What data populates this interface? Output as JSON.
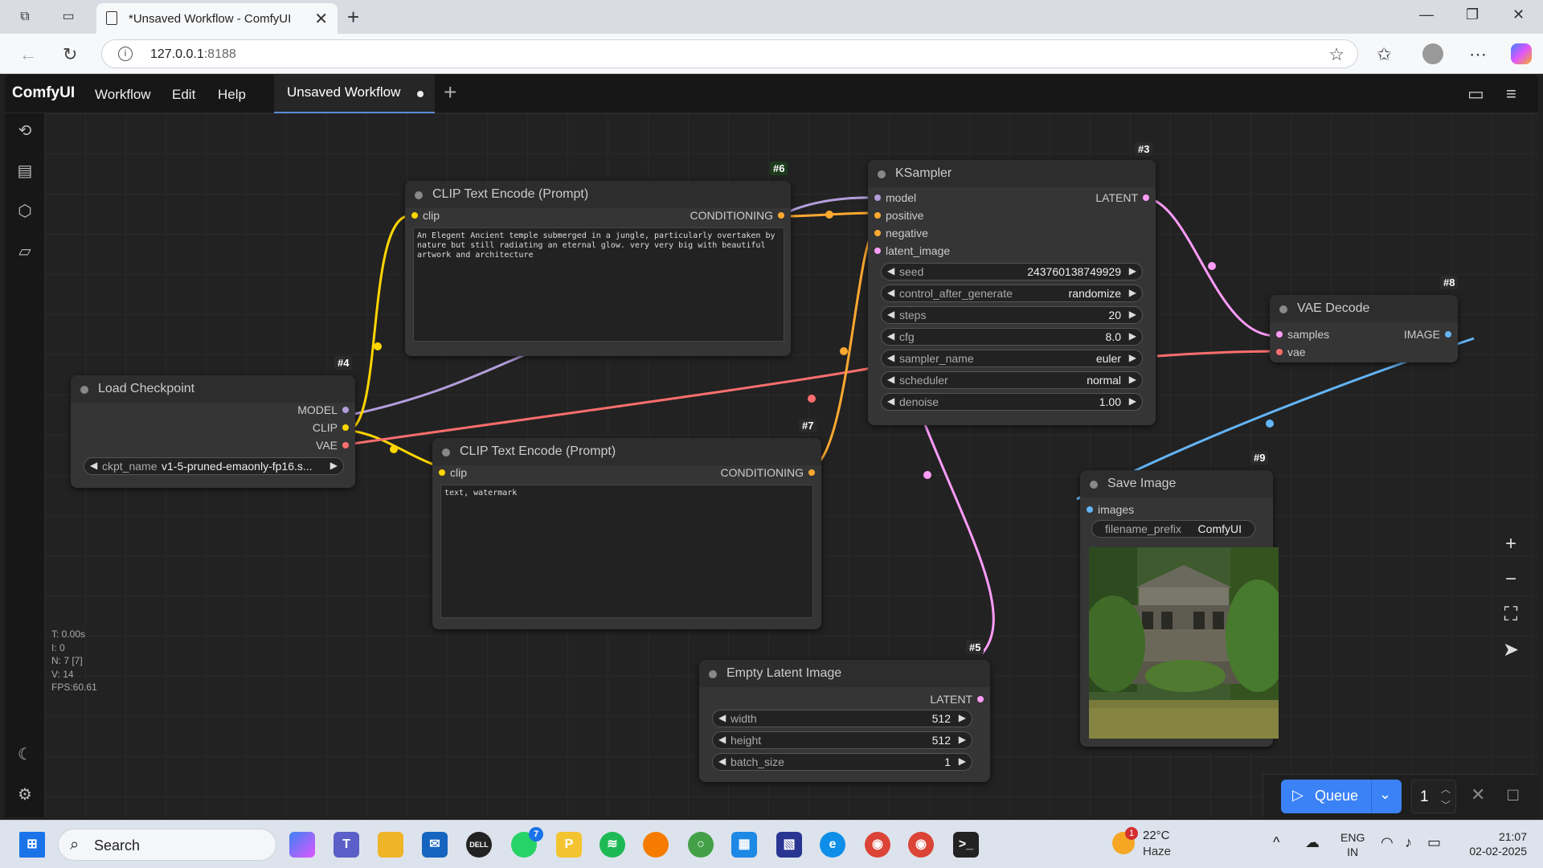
{
  "browser": {
    "tab_title": "*Unsaved Workflow - ComfyUI",
    "url_host": "127.0.0.1",
    "url_port": ":8188"
  },
  "app": {
    "logo": "ComfyUI",
    "menu": [
      "Workflow",
      "Edit",
      "Help"
    ],
    "workflow_tab": "Unsaved Workflow"
  },
  "nodes": {
    "clip_pos": {
      "id": "#6",
      "title": "CLIP Text Encode (Prompt)",
      "input": "clip",
      "output": "CONDITIONING",
      "text": "An Elegent Ancient temple submerged in a jungle, particularly overtaken by nature but still radiating an eternal glow. very very big with beautiful artwork and architecture"
    },
    "clip_neg": {
      "id": "#7",
      "title": "CLIP Text Encode (Prompt)",
      "input": "clip",
      "output": "CONDITIONING",
      "text": "text, watermark"
    },
    "checkpoint": {
      "id": "#4",
      "title": "Load Checkpoint",
      "outputs": [
        "MODEL",
        "CLIP",
        "VAE"
      ],
      "widget_name": "ckpt_name",
      "widget_value": "v1-5-pruned-emaonly-fp16.s..."
    },
    "ksampler": {
      "id": "#3",
      "title": "KSampler",
      "inputs": [
        "model",
        "positive",
        "negative",
        "latent_image"
      ],
      "output": "LATENT",
      "widgets": [
        {
          "name": "seed",
          "value": "243760138749929"
        },
        {
          "name": "control_after_generate",
          "value": "randomize"
        },
        {
          "name": "steps",
          "value": "20"
        },
        {
          "name": "cfg",
          "value": "8.0"
        },
        {
          "name": "sampler_name",
          "value": "euler"
        },
        {
          "name": "scheduler",
          "value": "normal"
        },
        {
          "name": "denoise",
          "value": "1.00"
        }
      ]
    },
    "vae_decode": {
      "id": "#8",
      "title": "VAE Decode",
      "inputs": [
        "samples",
        "vae"
      ],
      "output": "IMAGE"
    },
    "save_image": {
      "id": "#9",
      "title": "Save Image",
      "input": "images",
      "widget_name": "filename_prefix",
      "widget_value": "ComfyUI"
    },
    "empty_latent": {
      "id": "#5",
      "title": "Empty Latent Image",
      "output": "LATENT",
      "widgets": [
        {
          "name": "width",
          "value": "512"
        },
        {
          "name": "height",
          "value": "512"
        },
        {
          "name": "batch_size",
          "value": "1"
        }
      ]
    }
  },
  "stats": [
    "T: 0.00s",
    "I: 0",
    "N: 7 [7]",
    "V: 14",
    "FPS:60.61"
  ],
  "queue": {
    "label": "Queue",
    "count": "1"
  },
  "taskbar": {
    "search_label": "Search",
    "weather_temp": "22°C",
    "weather_cond": "Haze",
    "weather_badge": "1",
    "whatsapp_badge": "7",
    "lang": "ENG",
    "region": "IN",
    "time": "21:07",
    "date": "02-02-2025"
  },
  "colors": {
    "clip": "#ffd500",
    "conditioning": "#ffa931",
    "model": "#b39ddb",
    "latent": "#ff9cf9",
    "vae": "#ff6e6e",
    "image": "#64b5f6",
    "accent": "#3b82f6"
  }
}
